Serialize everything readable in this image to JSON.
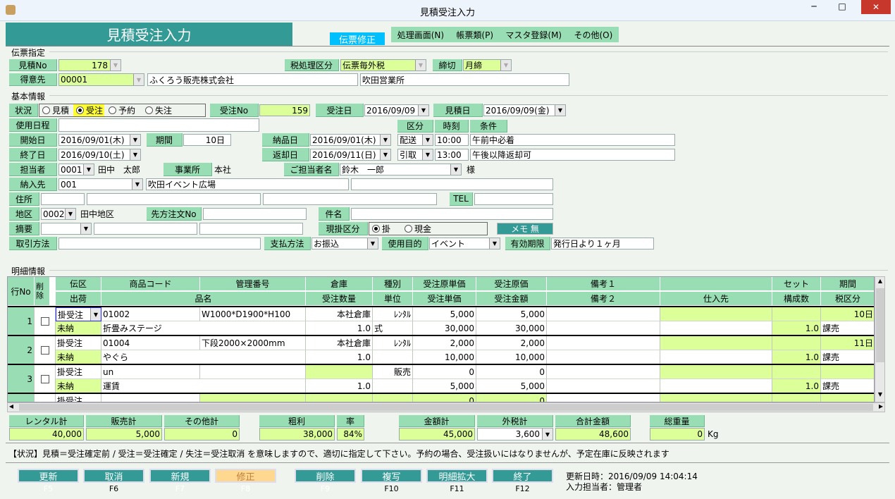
{
  "window": {
    "title": "見積受注入力",
    "controls": {
      "minimize": "─",
      "maximize": "□",
      "close": "✕"
    }
  },
  "header": {
    "title": "見積受注入力",
    "mode_badge": "伝票修正",
    "menu": [
      "処理画面(N)",
      "帳票類(P)",
      "マスタ登録(M)",
      "その他(O)"
    ]
  },
  "slip": {
    "section": "伝票指定",
    "estimate_no_label": "見積No",
    "estimate_no": "178",
    "tax_label": "税処理区分",
    "tax": "伝票毎外税",
    "closing_label": "締切",
    "closing": "月締",
    "customer_label": "得意先",
    "customer_code": "00001",
    "customer_name": "ふくろう販売株式会社",
    "customer_branch": "吹田営業所"
  },
  "basic": {
    "section": "基本情報",
    "status_label": "状況",
    "status_options": [
      "見積",
      "受注",
      "予約",
      "失注"
    ],
    "status_selected": "受注",
    "order_no_label": "受注No",
    "order_no": "159",
    "order_date_label": "受注日",
    "order_date": "2016/09/09",
    "estimate_date_label": "見積日",
    "estimate_date": "2016/09/09(金)",
    "schedule_label": "使用日程",
    "schedule": "",
    "col_kubun": "区分",
    "col_time": "時刻",
    "col_condition": "条件",
    "start_label": "開始日",
    "start_date": "2016/09/01(木)",
    "period_label": "期間",
    "period": "10日",
    "delivery_label": "納品日",
    "delivery_date": "2016/09/01(木)",
    "delivery_kubun": "配送",
    "delivery_time": "10:00",
    "delivery_condition": "午前中必着",
    "end_label": "終了日",
    "end_date": "2016/09/10(土)",
    "return_label": "返却日",
    "return_date": "2016/09/11(日)",
    "return_kubun": "引取",
    "return_time": "13:00",
    "return_condition": "午後以降返却可",
    "staff_label": "担当者",
    "staff_code": "0001",
    "staff_name": "田中　太郎",
    "office_label": "事業所",
    "office": "本社",
    "contact_label": "ご担当者名",
    "contact": "鈴木　一郎",
    "contact_suffix": "様",
    "dest_label": "納入先",
    "dest_code": "001",
    "dest_name": "吹田イベント広場",
    "address_label": "住所",
    "tel_label": "TEL",
    "area_label": "地区",
    "area_code": "0002",
    "area_name": "田中地区",
    "client_order_label": "先方注文No",
    "subject_label": "件名",
    "summary_label": "摘要",
    "payment_type_label": "現掛区分",
    "payment_type_options": [
      "掛",
      "現金"
    ],
    "payment_type_selected": "掛",
    "memo_button": "メモ 無",
    "trade_label": "取引方法",
    "pay_method_label": "支払方法",
    "pay_method": "お振込",
    "purpose_label": "使用目的",
    "purpose": "イベント",
    "valid_label": "有効期限",
    "valid": "発行日より１ヶ月"
  },
  "detail": {
    "section": "明細情報",
    "headers_top": [
      "行No",
      "削除",
      "伝区",
      "商品コード",
      "管理番号",
      "倉庫",
      "種別",
      "受注原単価",
      "受注原価",
      "備考１",
      "",
      "セット",
      "期間"
    ],
    "headers_bottom": [
      "出荷",
      "品名",
      "受注数量",
      "単位",
      "受注単価",
      "受注金額",
      "備考２",
      "仕入先",
      "構成数",
      "税区分"
    ],
    "rows": [
      {
        "no": "1",
        "top": [
          "掛受注",
          "01002",
          "W1000*D1900*H100",
          "本社倉庫",
          "ﾚﾝﾀﾙ",
          "5,000",
          "5,000",
          "",
          "",
          "",
          "10日"
        ],
        "bottom": [
          "未納",
          "折畳みステージ",
          "1.0",
          "式",
          "30,000",
          "30,000",
          "",
          "",
          "1.0",
          "課売"
        ]
      },
      {
        "no": "2",
        "top": [
          "掛受注",
          "01004",
          "下段2000×2000mm",
          "本社倉庫",
          "ﾚﾝﾀﾙ",
          "2,000",
          "2,000",
          "",
          "",
          "",
          "11日"
        ],
        "bottom": [
          "未納",
          "やぐら",
          "1.0",
          "",
          "10,000",
          "10,000",
          "",
          "",
          "1.0",
          "課売"
        ]
      },
      {
        "no": "3",
        "top": [
          "掛受注",
          "un",
          "",
          "",
          "販売",
          "0",
          "0",
          "",
          "",
          "",
          ""
        ],
        "bottom": [
          "未納",
          "運賃",
          "1.0",
          "",
          "5,000",
          "5,000",
          "",
          "",
          "1.0",
          "課売"
        ]
      },
      {
        "no": "",
        "top": [
          "掛受注",
          "",
          "",
          "",
          "",
          "0",
          "0",
          "",
          "",
          "",
          ""
        ],
        "bottom": [
          "",
          "",
          "",
          "",
          "",
          "",
          "",
          "",
          "",
          ""
        ]
      }
    ]
  },
  "totals": {
    "labels": [
      "レンタル計",
      "販売計",
      "その他計",
      "粗利",
      "率",
      "金額計",
      "外税計",
      "合計金額",
      "総重量"
    ],
    "values": [
      "40,000",
      "5,000",
      "0",
      "38,000",
      "84%",
      "45,000",
      "3,600",
      "48,600",
      "0"
    ],
    "weight_unit": "Kg"
  },
  "status_message": "【状況】見積＝受注確定前 / 受注＝受注確定 / 失注＝受注取消 を意味しますので、適切に指定して下さい。予約の場合、受注扱いにはなりませんが、予定在庫に反映されます",
  "buttons": [
    {
      "label": "更新",
      "key": "F5"
    },
    {
      "label": "取消",
      "key": "F6"
    },
    {
      "label": "新規",
      "key": "F7"
    },
    {
      "label": "修正",
      "key": "F8"
    },
    {
      "label": "削除",
      "key": "F9"
    },
    {
      "label": "複写",
      "key": "F10"
    },
    {
      "label": "明細拡大",
      "key": "F11"
    },
    {
      "label": "終了",
      "key": "F12"
    }
  ],
  "info": {
    "updated": "更新日時：2016/09/09 14:04:14",
    "operator": "入力担当者：管理者"
  },
  "colors": {
    "label_bg": "#99ddb4",
    "input_highlight": "#ddff99",
    "header_teal": "#339a96",
    "mode_badge": "#00bfff",
    "edit_button": "#ffd890"
  }
}
